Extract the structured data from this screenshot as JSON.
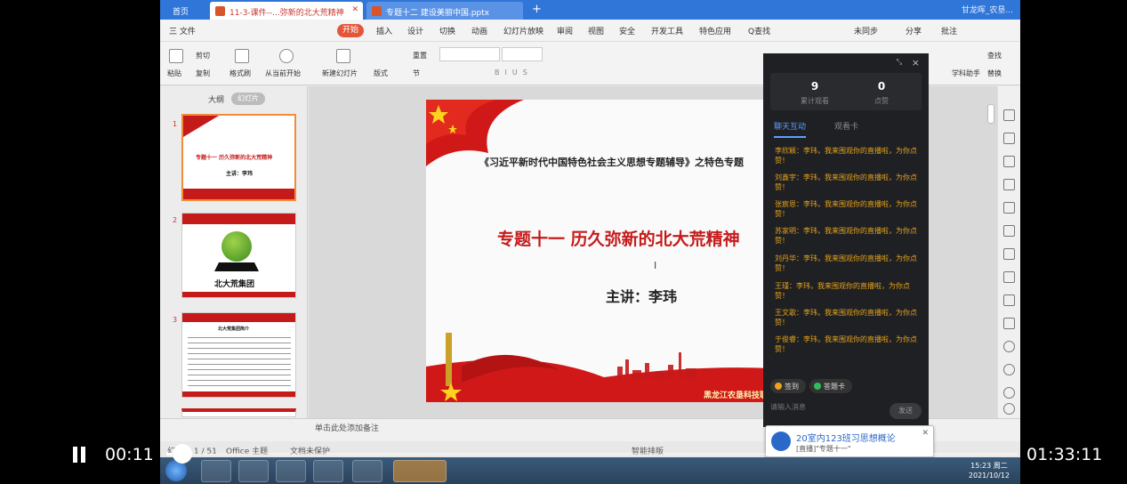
{
  "tabs": {
    "home": "首页",
    "doc1": "11-3-课件--...弥新的北大荒精神",
    "doc2": "专题十二 建设美丽中国.pptx",
    "new_tab": "+",
    "user": "甘龙晖_农垦..."
  },
  "menu": {
    "file": "三 文件",
    "start": "开始",
    "items": [
      "插入",
      "设计",
      "切换",
      "动画",
      "幻灯片放映",
      "审阅",
      "视图",
      "安全",
      "开发工具",
      "特色应用",
      "Q查找"
    ],
    "right": [
      "未同步",
      "分享",
      "批注"
    ]
  },
  "ribbon": {
    "paste": "粘贴",
    "cut": "剪切",
    "copy": "复制",
    "format_painter": "格式刷",
    "from_current": "从当前开始",
    "new_slide": "新建幻灯片",
    "layout": "版式",
    "section": "节",
    "reset": "重置",
    "find": "查找",
    "replace": "替换",
    "assistant": "学科助手"
  },
  "leftpane": {
    "outline": "大纲",
    "slides": "幻灯片",
    "thumb1_title": "专题十一 历久弥新的北大荒精神",
    "thumb1_speaker": "主讲：李玮",
    "thumb2_company": "北大荒集团",
    "thumb3_title": "北大荒集团简介",
    "numbers": [
      "1",
      "2",
      "3"
    ],
    "add": "+"
  },
  "slide": {
    "subtitle": "《习近平新时代中国特色社会主义思想专题辅导》之特色专题",
    "title": "专题十一  历久弥新的北大荒精神",
    "speaker": "主讲：李玮",
    "corp": "黑龙江农垦科技职业学院"
  },
  "status": {
    "slide_counter": "幻灯片 1 / 51",
    "theme": "Office 主题",
    "protect": "文档未保护",
    "notes": "单击此处添加备注",
    "smart": "智能排版"
  },
  "live_panel": {
    "viewers": "9",
    "viewers_label": "累计观看",
    "likes": "0",
    "likes_label": "点赞",
    "tab_chat": "聊天互动",
    "tab_cards": "观看卡",
    "messages": [
      "李欣颖：李玮，我来围观你的直播啦，为你点赞！",
      "刘鑫宇：李玮，我来围观你的直播啦，为你点赞！",
      "张宸恩：李玮，我来围观你的直播啦，为你点赞！",
      "苏家明：李玮，我来围观你的直播啦，为你点赞！",
      "刘丹华：李玮，我来围观你的直播啦，为你点赞！",
      "王瑾：李玮，我来围观你的直播啦，为你点赞！",
      "王文歌：李玮，我来围观你的直播啦，为你点赞！",
      "于俊睿：李玮，我来围观你的直播啦，为你点赞！"
    ],
    "signin": "签到",
    "answer_card": "答题卡",
    "input_placeholder": "请输入消息",
    "send": "发送",
    "close": "×"
  },
  "notification": {
    "title": "20室内123班习思想概论",
    "subtitle": "[直播]\"专题十一\""
  },
  "taskbar": {
    "time": "15:23 周二",
    "date": "2021/10/12"
  },
  "player": {
    "elapsed": "00:11",
    "duration": "01:33:11",
    "progress": 0.004
  },
  "colors": {
    "accent_red": "#c51a1a",
    "tab_blue": "#2f76d8",
    "chat_orange": "#e5a21b"
  }
}
